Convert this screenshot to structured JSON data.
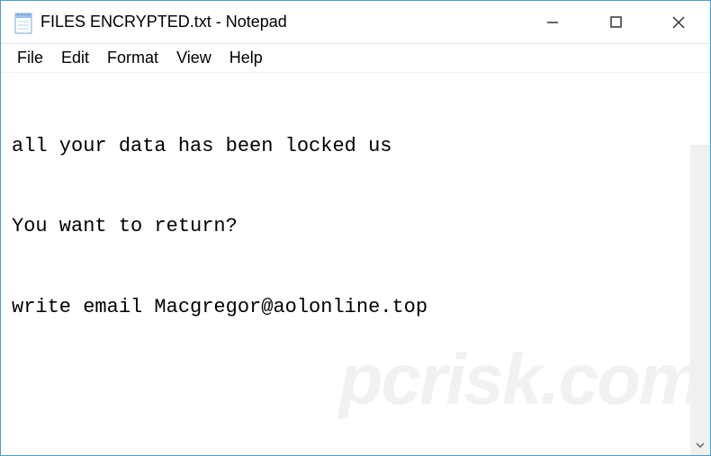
{
  "window": {
    "title": "FILES ENCRYPTED.txt - Notepad"
  },
  "menu": {
    "file": "File",
    "edit": "Edit",
    "format": "Format",
    "view": "View",
    "help": "Help"
  },
  "content": {
    "line1": "all your data has been locked us",
    "line2": "You want to return?",
    "line3": "write email Macgregor@aolonline.top"
  },
  "watermark": "pcrisk.com"
}
